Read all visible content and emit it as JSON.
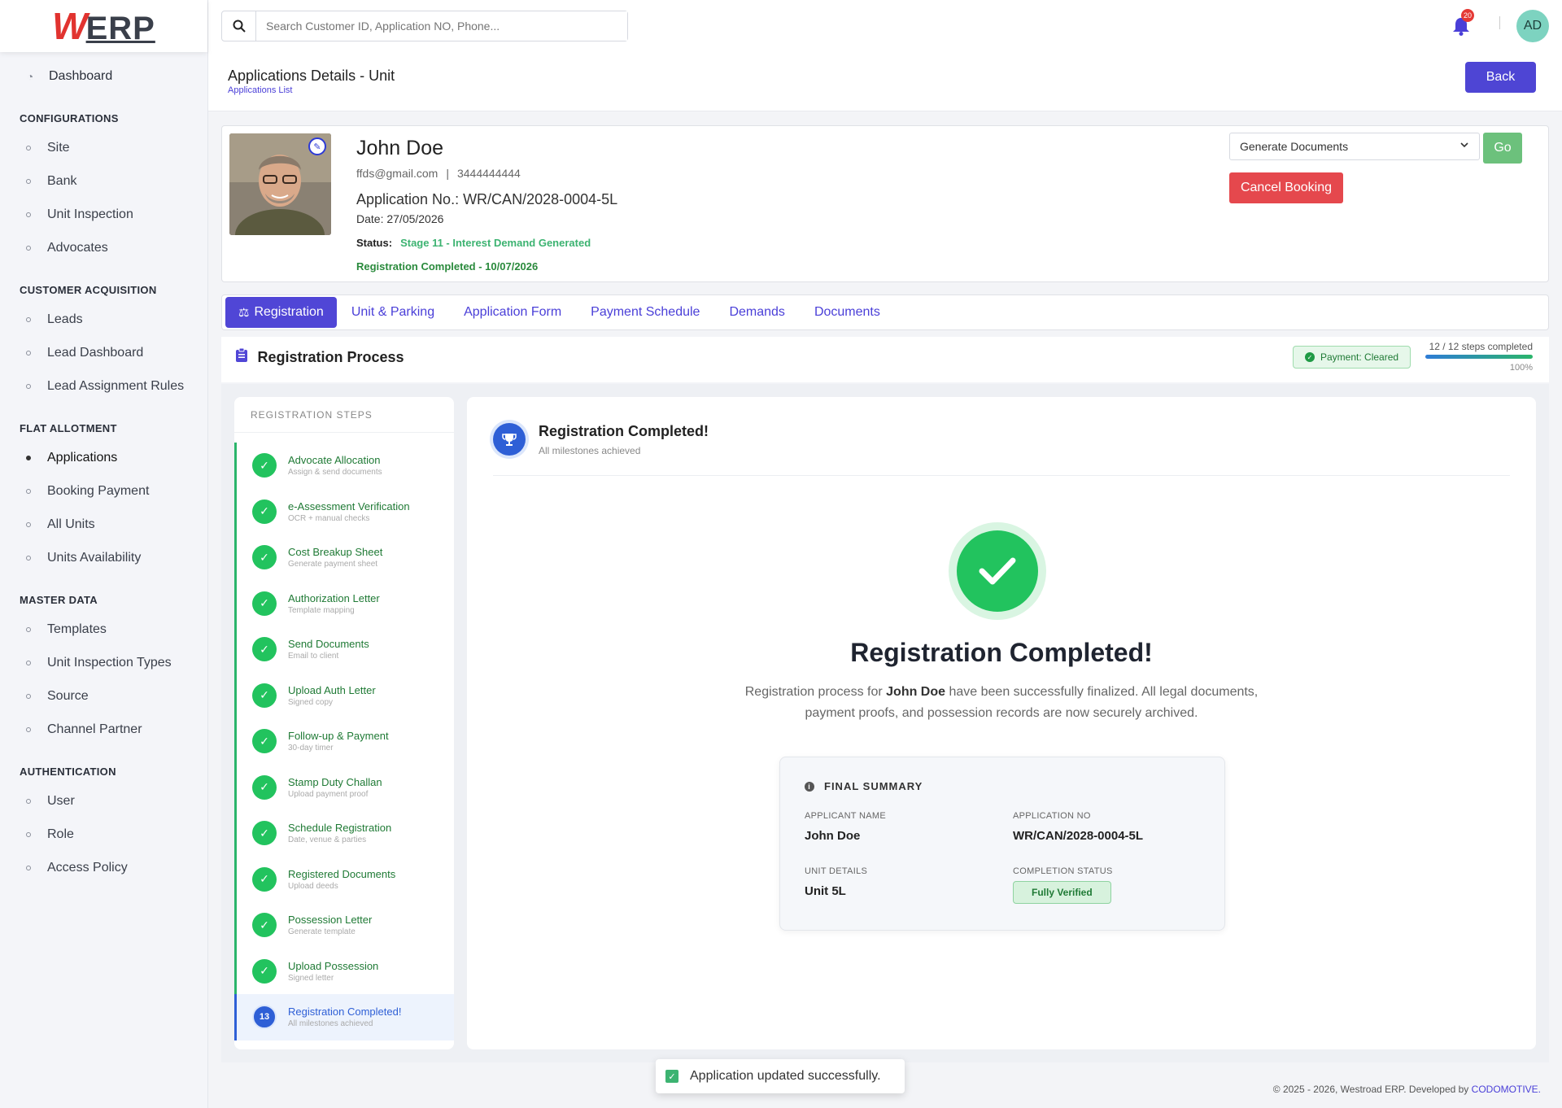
{
  "brand": {
    "logo_w": "W",
    "logo_rest": "ERP"
  },
  "sidebar": {
    "dashboard": "Dashboard",
    "sections": [
      {
        "title": "CONFIGURATIONS",
        "items": [
          "Site",
          "Bank",
          "Unit Inspection",
          "Advocates"
        ]
      },
      {
        "title": "CUSTOMER ACQUISITION",
        "items": [
          "Leads",
          "Lead Dashboard",
          "Lead Assignment Rules"
        ]
      },
      {
        "title": "FLAT ALLOTMENT",
        "items": [
          "Applications",
          "Booking Payment",
          "All Units",
          "Units Availability"
        ]
      },
      {
        "title": "MASTER DATA",
        "items": [
          "Templates",
          "Unit Inspection Types",
          "Source",
          "Channel Partner"
        ]
      },
      {
        "title": "AUTHENTICATION",
        "items": [
          "User",
          "Role",
          "Access Policy"
        ]
      }
    ],
    "active_item": "Applications"
  },
  "topbar": {
    "search_placeholder": "Search Customer ID, Application NO, Phone...",
    "notification_count": "20",
    "avatar_initials": "AD"
  },
  "header": {
    "title": "Applications Details - Unit",
    "breadcrumb": "Applications List",
    "back_label": "Back"
  },
  "profile": {
    "name": "John Doe",
    "email": "ffds@gmail.com",
    "separator": "|",
    "phone": "3444444444",
    "application_no": "Application No.: WR/CAN/2028-0004-5L",
    "date": "Date: 27/05/2026",
    "status_label": "Status:",
    "status_value": "Stage 11 - Interest Demand Generated",
    "registration_completed": "Registration Completed - 10/07/2026",
    "doc_select_value": "Generate Documents",
    "go_label": "Go",
    "cancel_label": "Cancel Booking"
  },
  "tabs": [
    "Registration",
    "Unit & Parking",
    "Application Form",
    "Payment Schedule",
    "Demands",
    "Documents"
  ],
  "process": {
    "title": "Registration Process",
    "payment_badge": "Payment: Cleared",
    "steps_completed": "12 / 12 steps completed",
    "progress_percent": 100,
    "progress_label": "100%"
  },
  "steps": {
    "heading": "REGISTRATION STEPS",
    "items": [
      {
        "title": "Advocate Allocation",
        "sub": "Assign & send documents"
      },
      {
        "title": "e-Assessment Verification",
        "sub": "OCR + manual checks"
      },
      {
        "title": "Cost Breakup Sheet",
        "sub": "Generate payment sheet"
      },
      {
        "title": "Authorization Letter",
        "sub": "Template mapping"
      },
      {
        "title": "Send Documents",
        "sub": "Email to client"
      },
      {
        "title": "Upload Auth Letter",
        "sub": "Signed copy"
      },
      {
        "title": "Follow-up & Payment",
        "sub": "30-day timer"
      },
      {
        "title": "Stamp Duty Challan",
        "sub": "Upload payment proof"
      },
      {
        "title": "Schedule Registration",
        "sub": "Date, venue & parties"
      },
      {
        "title": "Registered Documents",
        "sub": "Upload deeds"
      },
      {
        "title": "Possession Letter",
        "sub": "Generate template"
      },
      {
        "title": "Upload Possession",
        "sub": "Signed letter"
      }
    ],
    "current": {
      "number": "13",
      "title": "Registration Completed!",
      "sub": "All milestones achieved"
    }
  },
  "content": {
    "header_title": "Registration Completed!",
    "header_sub": "All milestones achieved",
    "big_title": "Registration Completed!",
    "desc_prefix": "Registration process for ",
    "desc_name": "John Doe",
    "desc_suffix": " have been successfully finalized. All legal documents, payment proofs, and possession records are now securely archived.",
    "summary": {
      "heading": "FINAL SUMMARY",
      "applicant_label": "APPLICANT NAME",
      "applicant_value": "John Doe",
      "appno_label": "APPLICATION NO",
      "appno_value": "WR/CAN/2028-0004-5L",
      "unit_label": "UNIT DETAILS",
      "unit_value": "Unit 5L",
      "status_label": "COMPLETION STATUS",
      "status_value": "Fully Verified"
    }
  },
  "toast": "Application updated successfully.",
  "footer": {
    "text": "© 2025 - 2026, Westroad ERP. Developed by ",
    "brand": "CODOMOTIVE."
  }
}
